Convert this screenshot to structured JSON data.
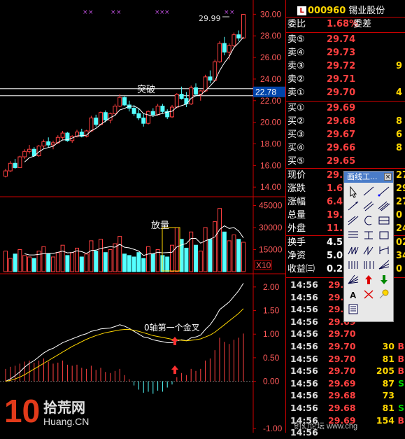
{
  "header": {
    "badge": "L",
    "code": "000960",
    "name": "锡业股份"
  },
  "order_ratio": {
    "label": "委比",
    "value": "1.68%",
    "diff_label": "委差"
  },
  "asks": [
    {
      "label": "卖⑤",
      "price": "29.74"
    },
    {
      "label": "卖④",
      "price": "29.73"
    },
    {
      "label": "卖③",
      "price": "29.72",
      "extra": "9"
    },
    {
      "label": "卖②",
      "price": "29.71"
    },
    {
      "label": "卖①",
      "price": "29.70",
      "extra": "4"
    }
  ],
  "bids": [
    {
      "label": "买①",
      "price": "29.69"
    },
    {
      "label": "买②",
      "price": "29.68",
      "extra": "8"
    },
    {
      "label": "买③",
      "price": "29.67",
      "extra": "6"
    },
    {
      "label": "买④",
      "price": "29.66",
      "extra": "8"
    },
    {
      "label": "买⑤",
      "price": "29.65"
    }
  ],
  "stats": [
    {
      "label": "现价",
      "value": "29.7",
      "extra": "27"
    },
    {
      "label": "涨跌",
      "value": "1.6",
      "extra": "29"
    },
    {
      "label": "涨幅",
      "value": "6.45",
      "extra": "27"
    },
    {
      "label": "总量",
      "value": "19.7",
      "extra": "0"
    },
    {
      "label": "外盘",
      "value": "11.5",
      "extra": "24"
    }
  ],
  "stats2": [
    {
      "label": "换手",
      "value": "4.55",
      "extra": "02"
    },
    {
      "label": "净资",
      "value": "5.0",
      "extra": "34"
    },
    {
      "label": "收益㈢",
      "value": "0.22",
      "extra": "0"
    }
  ],
  "ticks": [
    {
      "time": "14:56",
      "price": "29.69",
      "vol": "",
      "dir": ""
    },
    {
      "time": "14:56",
      "price": "29.69",
      "vol": "",
      "dir": ""
    },
    {
      "time": "14:56",
      "price": "29.70",
      "vol": "",
      "dir": ""
    },
    {
      "time": "14:56",
      "price": "29.69",
      "vol": "",
      "dir": ""
    },
    {
      "time": "14:56",
      "price": "29.70",
      "vol": "",
      "dir": ""
    },
    {
      "time": "14:56",
      "price": "29.70",
      "vol": "30",
      "dir": "B"
    },
    {
      "time": "14:56",
      "price": "29.70",
      "vol": "81",
      "dir": "B"
    },
    {
      "time": "14:56",
      "price": "29.70",
      "vol": "205",
      "dir": "B"
    },
    {
      "time": "14:56",
      "price": "29.69",
      "vol": "87",
      "dir": "S"
    },
    {
      "time": "14:56",
      "price": "29.68",
      "vol": "73",
      "dir": ""
    },
    {
      "time": "14:56",
      "price": "29.68",
      "vol": "81",
      "dir": "S"
    },
    {
      "time": "14:56",
      "price": "29.69",
      "vol": "154",
      "dir": "B"
    },
    {
      "time": "14:56",
      "price": "",
      "vol": "",
      "dir": ""
    }
  ],
  "toolbox": {
    "title": "画线工...",
    "close": "×",
    "text_tool": "A"
  },
  "watermark": {
    "digits": "10",
    "cn": "拾荒网",
    "url": "Huang.CN",
    "forum": "创幻论坛 www.chg"
  },
  "chart_data": {
    "type": "candlestick",
    "price_axis": {
      "ticks": [
        "30.00",
        "28.00",
        "26.00",
        "24.00",
        "22.00",
        "20.00",
        "18.00",
        "16.00",
        "14.00"
      ],
      "range": [
        13.3,
        30.8
      ]
    },
    "volume_axis": {
      "ticks": [
        "45000",
        "30000",
        "15000"
      ],
      "unit_label": "X10"
    },
    "macd_axis": {
      "ticks": [
        "2.00",
        "1.50",
        "1.00",
        "0.50",
        "0.00",
        "-1.00"
      ],
      "range": [
        -1.0,
        2.25
      ]
    },
    "annotations": {
      "high": "29.99",
      "breakout_level": "22.78",
      "breakout_text": "突破",
      "volume_text": "放量",
      "macd_text": "0轴第一个金叉"
    },
    "candles": [
      [
        15.0,
        15.7,
        14.9,
        15.5
      ],
      [
        15.5,
        16.4,
        15.4,
        16.2
      ],
      [
        16.2,
        16.6,
        15.7,
        15.8
      ],
      [
        15.8,
        16.9,
        15.8,
        16.8
      ],
      [
        16.8,
        17.5,
        16.6,
        17.3
      ],
      [
        17.3,
        17.9,
        17.1,
        17.5
      ],
      [
        17.5,
        17.7,
        16.8,
        16.9
      ],
      [
        16.9,
        17.9,
        16.8,
        17.8
      ],
      [
        17.8,
        18.4,
        17.6,
        18.2
      ],
      [
        18.2,
        18.6,
        17.7,
        17.9
      ],
      [
        17.9,
        18.3,
        17.5,
        18.1
      ],
      [
        18.1,
        18.8,
        18.0,
        18.6
      ],
      [
        18.6,
        19.2,
        18.4,
        19.0
      ],
      [
        19.0,
        19.1,
        18.2,
        18.3
      ],
      [
        18.3,
        18.8,
        18.1,
        18.7
      ],
      [
        18.7,
        19.3,
        18.6,
        19.1
      ],
      [
        19.1,
        19.4,
        18.6,
        18.7
      ],
      [
        18.7,
        19.3,
        18.6,
        19.2
      ],
      [
        19.2,
        20.6,
        19.1,
        20.4
      ],
      [
        20.4,
        20.7,
        19.6,
        19.8
      ],
      [
        19.8,
        21.0,
        19.7,
        20.9
      ],
      [
        20.9,
        21.1,
        20.0,
        20.2
      ],
      [
        20.2,
        20.9,
        19.9,
        20.8
      ],
      [
        20.8,
        21.7,
        20.7,
        21.5
      ],
      [
        21.5,
        22.6,
        21.4,
        22.3
      ],
      [
        22.3,
        22.4,
        21.5,
        21.6
      ],
      [
        21.6,
        22.0,
        21.0,
        21.3
      ],
      [
        21.3,
        21.6,
        20.6,
        20.8
      ],
      [
        20.8,
        21.3,
        20.2,
        20.4
      ],
      [
        20.4,
        20.8,
        19.6,
        19.9
      ],
      [
        19.9,
        21.1,
        19.8,
        21.0
      ],
      [
        21.0,
        21.3,
        20.5,
        20.7
      ],
      [
        20.7,
        21.7,
        20.6,
        21.5
      ],
      [
        21.5,
        21.7,
        20.8,
        21.0
      ],
      [
        21.0,
        21.2,
        20.3,
        20.5
      ],
      [
        20.5,
        21.6,
        20.4,
        21.4
      ],
      [
        21.4,
        22.7,
        21.3,
        22.6
      ],
      [
        22.6,
        23.3,
        22.1,
        22.2
      ],
      [
        22.2,
        22.8,
        21.4,
        21.7
      ],
      [
        21.7,
        23.4,
        21.6,
        23.2
      ],
      [
        23.2,
        23.6,
        22.4,
        22.6
      ],
      [
        22.6,
        23.0,
        22.0,
        22.9
      ],
      [
        22.9,
        24.4,
        22.8,
        24.2
      ],
      [
        24.2,
        24.8,
        23.6,
        23.9
      ],
      [
        23.9,
        25.8,
        23.8,
        25.6
      ],
      [
        25.6,
        27.5,
        25.5,
        27.3
      ],
      [
        27.3,
        27.9,
        26.2,
        26.5
      ],
      [
        26.5,
        27.3,
        25.8,
        27.1
      ],
      [
        27.1,
        28.3,
        26.9,
        28.1
      ],
      [
        28.1,
        28.5,
        27.5,
        27.8
      ],
      [
        27.8,
        30.0,
        27.7,
        29.99
      ]
    ],
    "volume": [
      14000,
      9000,
      12000,
      15000,
      11000,
      10000,
      9000,
      14000,
      17000,
      12000,
      10000,
      13000,
      18000,
      11000,
      13000,
      16000,
      10000,
      12000,
      21000,
      14000,
      22000,
      13000,
      15000,
      19000,
      24000,
      12000,
      11000,
      10000,
      13000,
      9000,
      17000,
      12000,
      15000,
      11000,
      10000,
      18000,
      30000,
      22000,
      16000,
      27000,
      18000,
      14000,
      30000,
      22000,
      34000,
      43000,
      27000,
      21000,
      25000,
      22000,
      20000
    ],
    "macd_hist": [
      0.12,
      0.14,
      0.15,
      0.17,
      0.19,
      0.2,
      0.18,
      0.2,
      0.22,
      0.19,
      0.17,
      0.18,
      0.2,
      0.16,
      0.15,
      0.16,
      0.13,
      0.12,
      0.15,
      0.11,
      0.13,
      0.09,
      0.08,
      0.1,
      0.12,
      0.06,
      0.02,
      -0.04,
      -0.08,
      -0.11,
      -0.1,
      -0.12,
      -0.09,
      -0.1,
      -0.06,
      -0.03,
      0.04,
      0.08,
      0.06,
      0.12,
      0.1,
      0.12,
      0.2,
      0.22,
      0.3,
      0.42,
      0.38,
      0.36,
      0.4,
      0.42,
      0.46
    ],
    "dif": [
      0.0,
      0.05,
      0.12,
      0.2,
      0.3,
      0.38,
      0.44,
      0.52,
      0.6,
      0.66,
      0.7,
      0.76,
      0.82,
      0.86,
      0.9,
      0.94,
      0.98,
      1.01,
      1.06,
      1.08,
      1.11,
      1.12,
      1.13,
      1.16,
      1.2,
      1.17,
      1.12,
      1.06,
      1.0,
      0.94,
      0.92,
      0.88,
      0.86,
      0.84,
      0.82,
      0.82,
      0.86,
      0.88,
      0.86,
      0.92,
      0.94,
      0.98,
      1.1,
      1.2,
      1.34,
      1.52,
      1.6,
      1.68,
      1.8,
      1.92,
      2.08
    ],
    "dea": [
      0.0,
      0.02,
      0.05,
      0.09,
      0.14,
      0.2,
      0.26,
      0.32,
      0.38,
      0.44,
      0.5,
      0.56,
      0.62,
      0.68,
      0.74,
      0.79,
      0.84,
      0.89,
      0.93,
      0.97,
      1.0,
      1.03,
      1.05,
      1.07,
      1.09,
      1.1,
      1.1,
      1.08,
      1.06,
      1.03,
      1.0,
      0.97,
      0.95,
      0.93,
      0.91,
      0.89,
      0.88,
      0.87,
      0.86,
      0.87,
      0.88,
      0.9,
      0.94,
      0.98,
      1.04,
      1.12,
      1.2,
      1.28,
      1.36,
      1.44,
      1.54
    ]
  }
}
